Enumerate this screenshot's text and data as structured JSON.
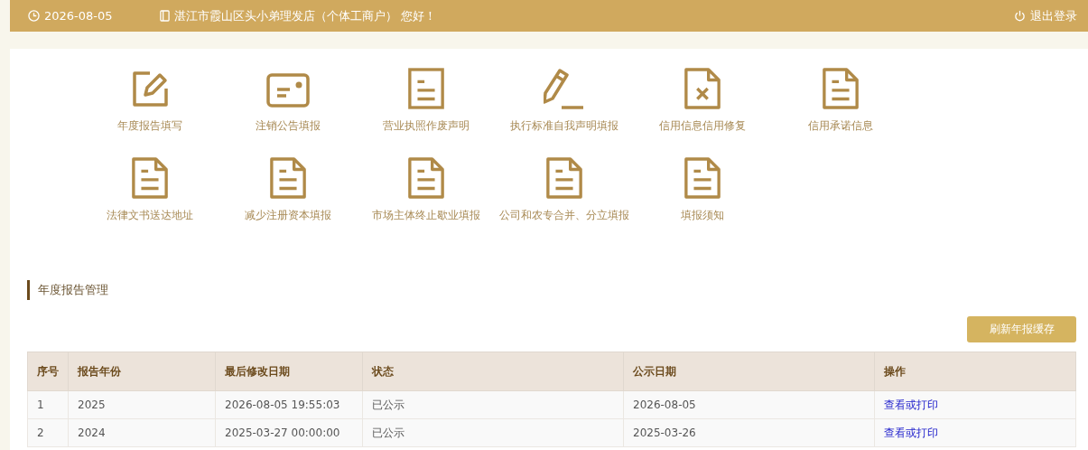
{
  "header": {
    "date": "2026-08-05",
    "greeting": "湛江市霞山区头小弟理发店（个体工商户） 您好！",
    "logout": "退出登录"
  },
  "tiles": [
    {
      "kind": "edit",
      "label": "年度报告填写"
    },
    {
      "kind": "card",
      "label": "注销公告填报"
    },
    {
      "kind": "doc",
      "label": "营业执照作废声明"
    },
    {
      "kind": "pencil",
      "label": "执行标准自我声明填报"
    },
    {
      "kind": "docx",
      "label": "信用信息信用修复"
    },
    {
      "kind": "fold",
      "label": "信用承诺信息"
    },
    {
      "kind": "fold",
      "label": "法律文书送达地址"
    },
    {
      "kind": "fold",
      "label": "减少注册资本填报"
    },
    {
      "kind": "fold",
      "label": "市场主体终止歇业填报"
    },
    {
      "kind": "fold",
      "label": "公司和农专合并、分立填报"
    },
    {
      "kind": "fold",
      "label": "填报须知"
    }
  ],
  "section": {
    "title": "年度报告管理",
    "refresh_button": "刷新年报缓存"
  },
  "table": {
    "columns": [
      "序号",
      "报告年份",
      "最后修改日期",
      "状态",
      "公示日期",
      "操作"
    ],
    "rows": [
      {
        "no": "1",
        "year": "2025",
        "modified": "2026-08-05 19:55:03",
        "status": "已公示",
        "published": "2026-08-05",
        "action": "查看或打印"
      },
      {
        "no": "2",
        "year": "2024",
        "modified": "2025-03-27 00:00:00",
        "status": "已公示",
        "published": "2025-03-26",
        "action": "查看或打印"
      }
    ]
  }
}
